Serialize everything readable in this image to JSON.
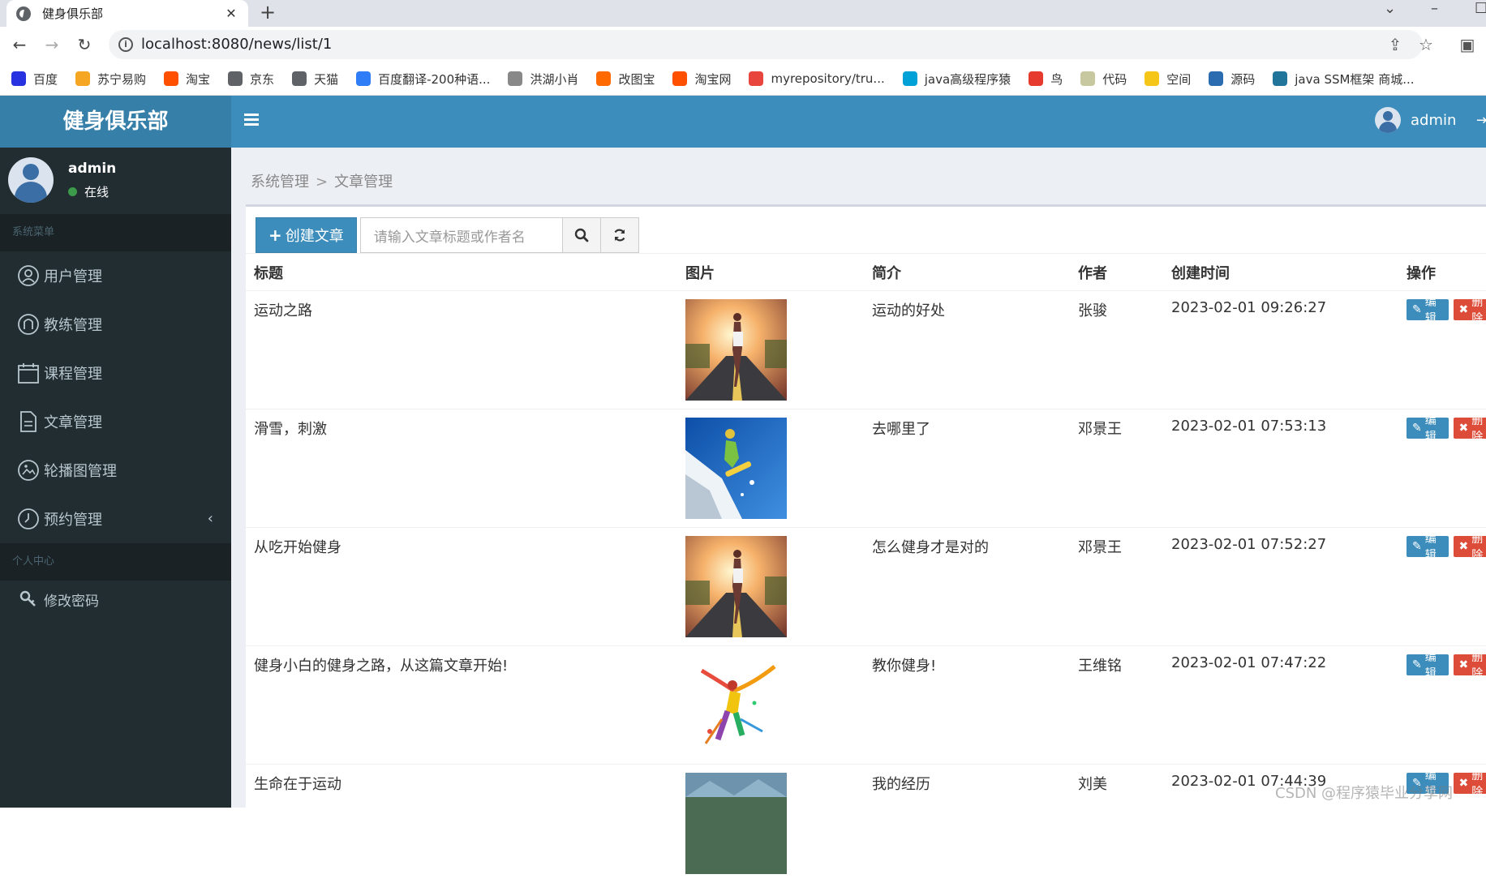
{
  "browser": {
    "tab_title": "健身俱乐部",
    "tab_close": "✕",
    "new_tab": "+",
    "url": "localhost:8080/news/list/1",
    "bookmarks": [
      {
        "label": "百度",
        "color": "#2932e1"
      },
      {
        "label": "苏宁易购",
        "color": "#f5a623"
      },
      {
        "label": "淘宝",
        "color": "#ff5000"
      },
      {
        "label": "京东",
        "color": "#5f6368"
      },
      {
        "label": "天猫",
        "color": "#5f6368"
      },
      {
        "label": "百度翻译-200种语...",
        "color": "#2e7cf6"
      },
      {
        "label": "洪湖小肖",
        "color": "#888888"
      },
      {
        "label": "改图宝",
        "color": "#ff6a00"
      },
      {
        "label": "淘宝网",
        "color": "#ff5000"
      },
      {
        "label": "myrepository/tru...",
        "color": "#e8453c"
      },
      {
        "label": "java高级程序猿",
        "color": "#00a1d6"
      },
      {
        "label": "鸟",
        "color": "#e63a2e"
      },
      {
        "label": "代码",
        "color": "#c8c8a0"
      },
      {
        "label": "空间",
        "color": "#f5c518"
      },
      {
        "label": "源码",
        "color": "#2b6cb0"
      },
      {
        "label": "java SSM框架 商城...",
        "color": "#21759b"
      }
    ]
  },
  "app": {
    "logo": "健身俱乐部",
    "user": {
      "name": "admin",
      "status": "在线"
    },
    "menu_header_system": "系统菜单",
    "menu_items": [
      {
        "label": "用户管理",
        "icon": "user-circle-icon"
      },
      {
        "label": "教练管理",
        "icon": "coach-icon"
      },
      {
        "label": "课程管理",
        "icon": "calendar-icon"
      },
      {
        "label": "文章管理",
        "icon": "document-icon"
      },
      {
        "label": "轮播图管理",
        "icon": "image-carousel-icon"
      },
      {
        "label": "预约管理",
        "icon": "clock-icon"
      }
    ],
    "caret": "‹",
    "menu_header_personal": "个人中心",
    "personal_items": [
      {
        "label": "修改密码",
        "icon": "key-icon"
      }
    ],
    "topbar_user": "admin",
    "breadcrumb": {
      "parent": "系统管理",
      "sep": ">",
      "current": "文章管理"
    },
    "create_button": "创建文章",
    "search_placeholder": "请输入文章标题或作者名",
    "table": {
      "headers": [
        "标题",
        "图片",
        "简介",
        "作者",
        "创建时间",
        "操作"
      ],
      "rows": [
        {
          "title": "运动之路",
          "image": "runner-sunset",
          "intro": "运动的好处",
          "author": "张骏",
          "created": "2023-02-01 09:26:27"
        },
        {
          "title": "滑雪，刺激",
          "image": "snowboarder",
          "intro": "去哪里了",
          "author": "邓景王",
          "created": "2023-02-01 07:53:13"
        },
        {
          "title": "从吃开始健身",
          "image": "runner-sunset",
          "intro": "怎么健身才是对的",
          "author": "邓景王",
          "created": "2023-02-01 07:52:27"
        },
        {
          "title": "健身小白的健身之路，从这篇文章开始!",
          "image": "paint-dancer",
          "intro": "教你健身!",
          "author": "王维铭",
          "created": "2023-02-01 07:47:22"
        },
        {
          "title": "生命在于运动",
          "image": "landscape",
          "intro": "我的经历",
          "author": "刘美",
          "created": "2023-02-01 07:44:39"
        }
      ],
      "edit_label": "编辑",
      "delete_label": "删除"
    },
    "watermark": "CSDN @程序猿毕业分享网"
  },
  "colors": {
    "topbar": "#3c8dbc",
    "logo_bg": "#367fa9",
    "sidebar": "#222d32",
    "edit_btn": "#3c8dbc",
    "delete_btn": "#dd4b39"
  }
}
